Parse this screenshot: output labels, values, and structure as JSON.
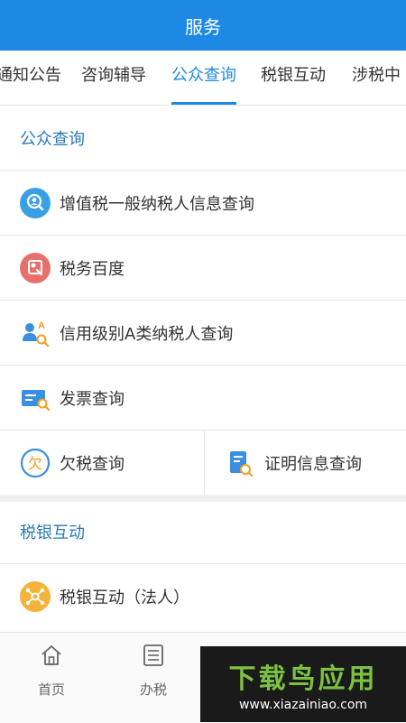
{
  "header": {
    "title": "服务"
  },
  "tabs": [
    {
      "label": "通知公告"
    },
    {
      "label": "咨询辅导"
    },
    {
      "label": "公众查询"
    },
    {
      "label": "税银互动"
    },
    {
      "label": "涉税中"
    }
  ],
  "sections": {
    "public_query": {
      "title": "公众查询",
      "items": [
        {
          "label": "增值税一般纳税人信息查询",
          "icon": "search-person-icon"
        },
        {
          "label": "税务百度",
          "icon": "baidu-icon"
        },
        {
          "label": "信用级别A类纳税人查询",
          "icon": "credit-user-icon"
        },
        {
          "label": "发票查询",
          "icon": "invoice-search-icon"
        },
        {
          "label": "欠税查询",
          "icon": "arrears-icon"
        },
        {
          "label": "证明信息查询",
          "icon": "certificate-search-icon"
        }
      ]
    },
    "tax_bank": {
      "title": "税银互动",
      "items": [
        {
          "label": "税银互动（法人）",
          "icon": "network-icon"
        }
      ]
    }
  },
  "tabbar": [
    {
      "label": "首页",
      "icon": "home-icon"
    },
    {
      "label": "办税",
      "icon": "list-icon"
    }
  ],
  "watermark": {
    "title": "下载鸟应用",
    "url": "www.xiazainiao.com"
  },
  "colors": {
    "brand": "#1e88e5",
    "section_title": "#2a7ab8"
  }
}
